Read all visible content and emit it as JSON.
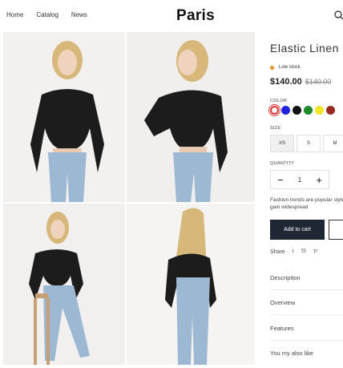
{
  "header": {
    "nav": [
      "Home",
      "Catalog",
      "News"
    ],
    "logo": "Paris"
  },
  "product": {
    "title": "Elastic Linen",
    "stock": "Low stock",
    "price": "$140.00",
    "old_price": "$140.00",
    "color_label": "COLOR",
    "colors": [
      "#ffffff",
      "#2222dd",
      "#111111",
      "#1f8a2a",
      "#f1e52a",
      "#9b2a22"
    ],
    "selected_color": "#ffffff",
    "size_label": "SIZE",
    "sizes": [
      "XS",
      "S",
      "M"
    ],
    "selected_size": "XS",
    "quantity_label": "QUANTITY",
    "quantity": "1",
    "description": "Fashion trends are popular styles that gain widespread",
    "add_to_cart": "Add to cart",
    "share_label": "Share",
    "accordion": [
      "Description",
      "Overview",
      "Features",
      "You my also like"
    ]
  },
  "icons": {
    "search": "search-icon",
    "facebook": "facebook-icon",
    "twitter": "twitter-icon",
    "pinterest": "pinterest-icon"
  }
}
